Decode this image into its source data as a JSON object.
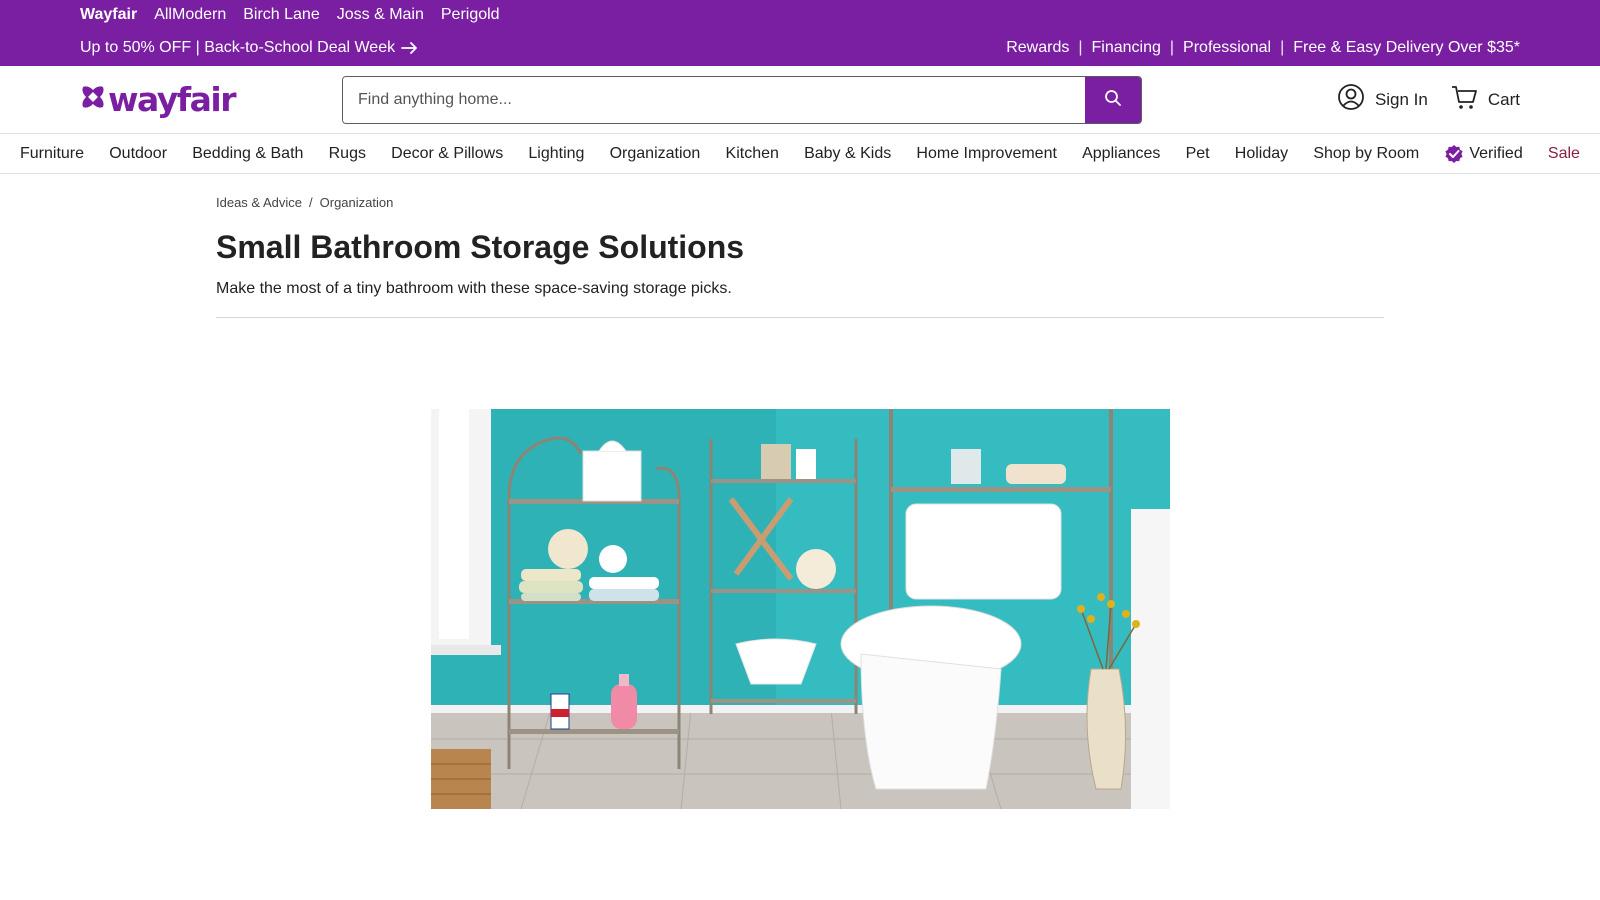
{
  "brands": [
    "Wayfair",
    "AllModern",
    "Birch Lane",
    "Joss & Main",
    "Perigold"
  ],
  "promo": {
    "text": "Up to 50% OFF | Back-to-School Deal Week"
  },
  "utility_links": [
    "Rewards",
    "Financing",
    "Professional",
    "Free & Easy Delivery Over $35*"
  ],
  "header": {
    "logo_text": "wayfair",
    "search_placeholder": "Find anything home...",
    "sign_in": "Sign In",
    "cart": "Cart"
  },
  "categories": [
    "Furniture",
    "Outdoor",
    "Bedding & Bath",
    "Rugs",
    "Decor & Pillows",
    "Lighting",
    "Organization",
    "Kitchen",
    "Baby & Kids",
    "Home Improvement",
    "Appliances",
    "Pet",
    "Holiday",
    "Shop by Room",
    "Verified",
    "Sale"
  ],
  "breadcrumb": [
    "Ideas & Advice",
    "Organization"
  ],
  "breadcrumb_separator": "/",
  "article": {
    "title": "Small Bathroom Storage Solutions",
    "subtitle": "Make the most of a tiny bathroom with these space-saving storage picks."
  },
  "colors": {
    "brand_purple": "#7b1fa2",
    "sale_red": "#8a1f3f",
    "wall_teal": "#2db3b7"
  },
  "icons": [
    "arrow-right-icon",
    "wayfair-logo-icon",
    "search-icon",
    "user-icon",
    "cart-icon",
    "verified-badge-icon"
  ]
}
